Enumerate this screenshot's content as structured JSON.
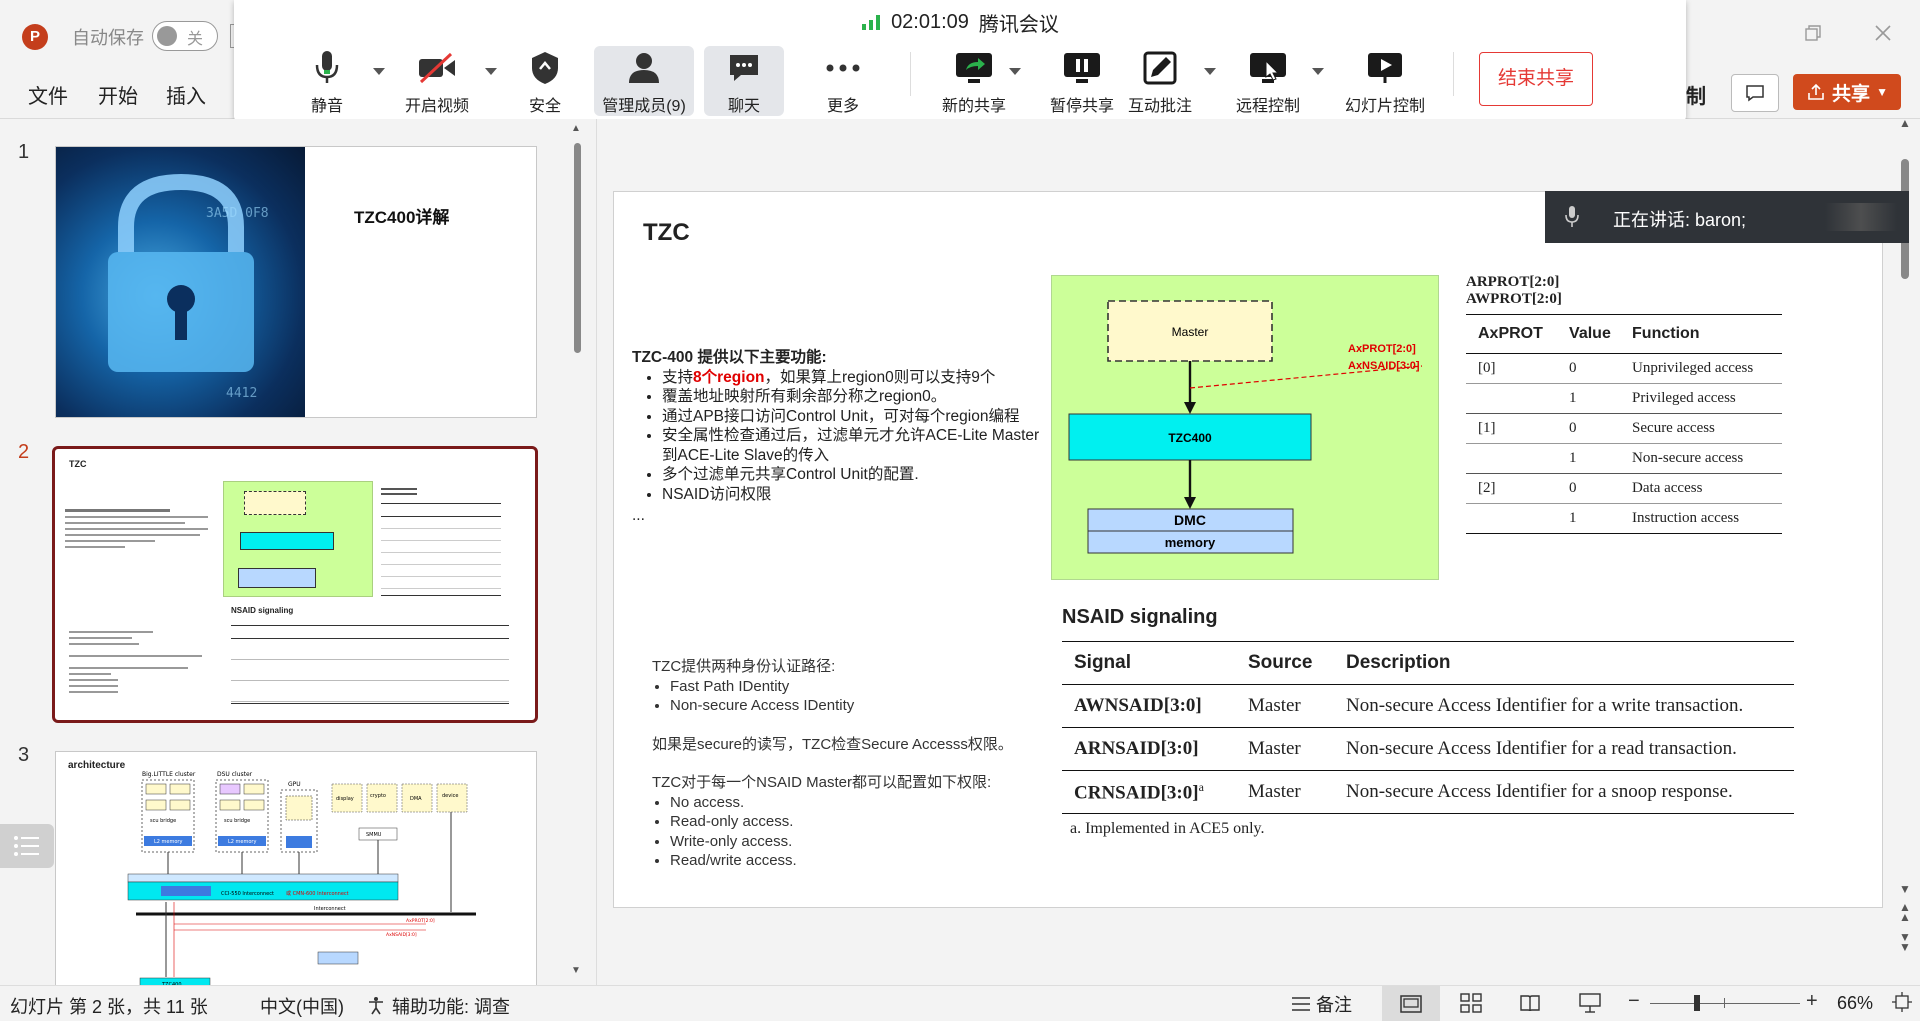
{
  "app": {
    "autosave_label": "自动保存",
    "autosave_state": "关"
  },
  "ribbon": {
    "tabs": [
      "文件",
      "开始",
      "插入"
    ],
    "partial_tab": "制",
    "share_label": "共享"
  },
  "meeting": {
    "time": "02:01:09",
    "app_name": "腾讯会议",
    "buttons": {
      "mute": "静音",
      "video": "开启视频",
      "security": "安全",
      "members": "管理成员(9)",
      "chat": "聊天",
      "more": "更多",
      "new_share": "新的共享",
      "pause_share": "暂停共享",
      "annotate": "互动批注",
      "remote": "远程控制",
      "slideshow": "幻灯片控制"
    },
    "end_share": "结束共享",
    "speaking": "正在讲话: baron;"
  },
  "thumbnails": [
    {
      "num": "1",
      "title": "TZC400详解"
    },
    {
      "num": "2",
      "title": "TZC",
      "nsaid_title": "NSAID signaling"
    },
    {
      "num": "3",
      "title": "architecture",
      "labels": {
        "big_little": "Big.LITTLE  cluster",
        "dsu": "DSU  cluster",
        "gpu": "GPU",
        "display": "display",
        "crypto": "crypto engine",
        "dma": "DMA",
        "device": "device I/O",
        "scu": "scu bridge",
        "l2": "L2 memory",
        "smmu": "SMMU",
        "snoop": "snoop filter",
        "cci": "CCI-550  Interconnect",
        "cmn": "或 CMN-600 Interconnect",
        "interconnect": "Interconnect",
        "tzc": "TZC400",
        "peripherals": "Peripherals",
        "axprot": "AxPROT[2:0]",
        "axnsaid": "AxNSAID[3:0]",
        "axi": "AXI",
        "ace": "ACE",
        "ace_lite": "ACE-Lite Master"
      }
    }
  ],
  "slide": {
    "title": "TZC",
    "features_heading": "TZC-400 提供以下主要功能:",
    "features": [
      {
        "pre": "支持",
        "highlight": "8个region",
        "post": "，如果算上region0则可以支持9个"
      },
      {
        "pre": "覆盖地址映射所有剩余部分称之region0。",
        "highlight": "",
        "post": ""
      },
      {
        "pre": "通过APB接口访问Control Unit，可对每个region编程",
        "highlight": "",
        "post": ""
      },
      {
        "pre": "安全属性检查通过后，过滤单元才允许ACE-Lite Master到ACE-Lite Slave的传入",
        "highlight": "",
        "post": ""
      },
      {
        "pre": "多个过滤单元共享Control Unit的配置.",
        "highlight": "",
        "post": ""
      },
      {
        "pre": "NSAID访问权限",
        "highlight": "",
        "post": ""
      }
    ],
    "ellipsis": "...",
    "identity_heading": "TZC提供两种身份认证路径:",
    "identity": [
      "Fast Path IDentity",
      "Non-secure Access IDentity"
    ],
    "secure_check": "如果是secure的读写，TZC检查Secure Accesss权限。",
    "perm_heading": "TZC对于每一个NSAID Master都可以配置如下权限:",
    "perms": [
      "No access.",
      "Read-only access.",
      "Write-only access.",
      "Read/write access."
    ],
    "diagram": {
      "master": "Master",
      "tzc": "TZC400",
      "dmc": "DMC",
      "memory": "memory",
      "axprot": "AxPROT[2:0]",
      "axnsaid": "AxNSAID[3:0]"
    },
    "axprot_table": {
      "caption1": "ARPROT[2:0]",
      "caption2": "AWPROT[2:0]",
      "headers": [
        "AxPROT",
        "Value",
        "Function"
      ],
      "rows": [
        [
          "[0]",
          "0",
          "Unprivileged access"
        ],
        [
          "",
          "1",
          "Privileged access"
        ],
        [
          "[1]",
          "0",
          "Secure access"
        ],
        [
          "",
          "1",
          "Non-secure access"
        ],
        [
          "[2]",
          "0",
          "Data access"
        ],
        [
          "",
          "1",
          "Instruction access"
        ]
      ]
    },
    "nsaid": {
      "title": "NSAID signaling",
      "headers": [
        "Signal",
        "Source",
        "Description"
      ],
      "rows": [
        [
          "AWNSAID[3:0]",
          "",
          "Master",
          "Non-secure Access Identifier for a write transaction."
        ],
        [
          "ARNSAID[3:0]",
          "",
          "Master",
          "Non-secure Access Identifier for a read transaction."
        ],
        [
          "CRNSAID[3:0]",
          "a",
          "Master",
          "Non-secure Access Identifier for a snoop response."
        ]
      ],
      "footnote": "a.   Implemented in ACE5 only."
    }
  },
  "status": {
    "slide_info": "幻灯片 第 2 张，共 11 张",
    "language": "中文(中国)",
    "accessibility": "辅助功能: 调查",
    "notes": "备注",
    "zoom": "66%"
  },
  "colors": {
    "ppt_red": "#c43e1c",
    "share_orange": "#d04a1d",
    "end_share_red": "#e53935",
    "green_signal": "#2bb24c",
    "diagram_bg": "#ccff99",
    "master_fill": "#fff9cc",
    "tzc_fill": "#00f0f0",
    "dmc_fill": "#b8d8ff",
    "highlight_red": "#e00000",
    "selected_border": "#7a1a1a"
  }
}
